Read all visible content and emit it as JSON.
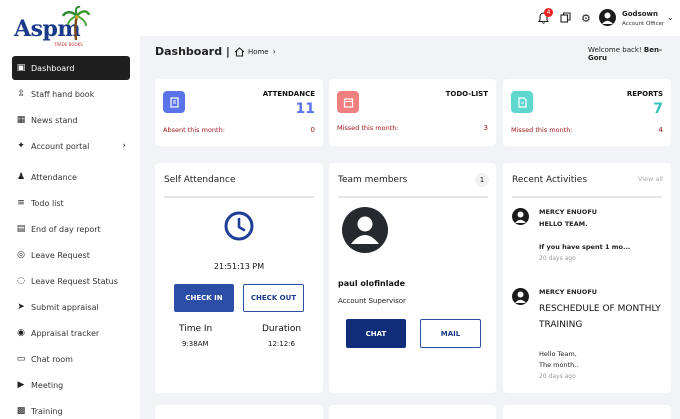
{
  "brand": {
    "logo_text": "Aspm",
    "logo_sub": "TRADE BOOKS"
  },
  "sidebar": {
    "items": [
      {
        "label": "Dashboard",
        "icon": "dashboard-icon"
      },
      {
        "label": "Staff hand book",
        "icon": "upload-icon"
      },
      {
        "label": "News stand",
        "icon": "newspaper-icon"
      },
      {
        "label": "Account portal",
        "icon": "compass-icon"
      },
      {
        "label": "Attendance",
        "icon": "person-check-icon"
      },
      {
        "label": "Todo list",
        "icon": "list-icon"
      },
      {
        "label": "End of day report",
        "icon": "clipboard-icon"
      },
      {
        "label": "Leave Request",
        "icon": "leave-icon"
      },
      {
        "label": "Leave Request Status",
        "icon": "status-icon"
      },
      {
        "label": "Submit appraisal",
        "icon": "send-icon"
      },
      {
        "label": "Appraisal tracker",
        "icon": "tracker-icon"
      },
      {
        "label": "Chat room",
        "icon": "chat-icon"
      },
      {
        "label": "Meeting",
        "icon": "video-icon"
      },
      {
        "label": "Training",
        "icon": "training-icon"
      }
    ]
  },
  "topbar": {
    "notification_count": "4",
    "user_name": "Godsown",
    "user_role": "Account Officer"
  },
  "header": {
    "title": "Dashboard |",
    "breadcrumb": "Home",
    "welcome_prefix": "Welcome back!",
    "welcome_name": "Ben-Goru"
  },
  "stats": [
    {
      "title": "ATTENDANCE",
      "value": "11",
      "sub": "Absent this month:",
      "sub_value": "0",
      "color": "#5a73e8",
      "value_color": "#5a73e8"
    },
    {
      "title": "TODO-LIST",
      "value": "",
      "sub": "Missed this month:",
      "sub_value": "3",
      "color": "#f08080",
      "value_color": "#e05555"
    },
    {
      "title": "REPORTS",
      "value": "7",
      "sub": "Missed this month:",
      "sub_value": "4",
      "color": "#5ed8cf",
      "value_color": "#36c2b8"
    }
  ],
  "self_attendance": {
    "title": "Self Attendance",
    "time": "21:51:13 PM",
    "check_in": "CHECK IN",
    "check_out": "CHECK OUT",
    "time_in_label": "Time In",
    "time_in": "9:38AM",
    "duration_label": "Duration",
    "duration": "12:12:6"
  },
  "team": {
    "title": "Team members",
    "count": "1",
    "member_name": "paul olofinlade",
    "member_role": "Account Supervisor",
    "chat": "CHAT",
    "mail": "MAIL"
  },
  "activities": {
    "title": "Recent Activities",
    "view_all": "View all",
    "items": [
      {
        "author": "MERCY ENUOFU",
        "title": "HELLO TEAM.",
        "body": "If you have spent 1 mo...",
        "body2": "",
        "time": "20 days ago"
      },
      {
        "author": "MERCY ENUOFU",
        "title": "RESCHEDULE OF MONTHLY TRAINING",
        "body": "Hello Team,",
        "body2": "The month..",
        "time": "20 days ago"
      }
    ]
  },
  "colors": {
    "accent": "#2c4ea6",
    "dark": "#1f1f1f",
    "danger": "#a01818"
  }
}
